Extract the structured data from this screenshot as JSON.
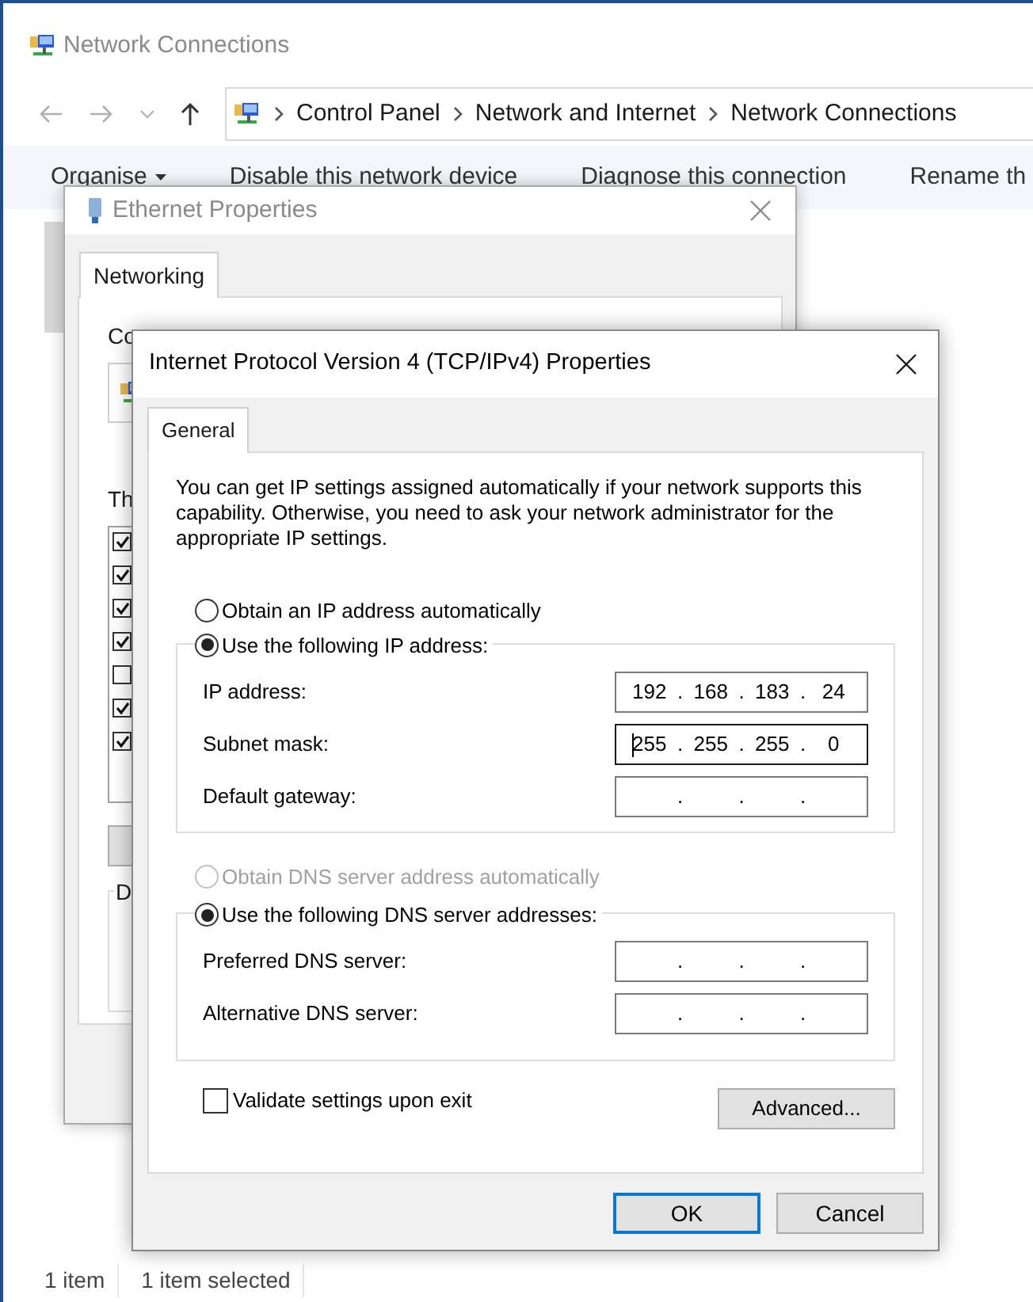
{
  "explorer": {
    "title": "Network Connections",
    "breadcrumb": [
      "Control Panel",
      "Network and Internet",
      "Network Connections"
    ],
    "toolbar": [
      {
        "label": "Organise",
        "dropdown": true
      },
      {
        "label": "Disable this network device",
        "dropdown": false
      },
      {
        "label": "Diagnose this connection",
        "dropdown": false
      },
      {
        "label": "Rename th",
        "dropdown": false
      }
    ],
    "status_bar": [
      "1 item",
      "1 item selected"
    ]
  },
  "ethernet_dialog": {
    "title": "Ethernet Properties",
    "tabs": [
      {
        "label": "Networking",
        "selected": true
      }
    ],
    "connect_label": "Co",
    "components_label": "Th",
    "components": [
      {
        "checked": true
      },
      {
        "checked": true
      },
      {
        "checked": true
      },
      {
        "checked": true
      },
      {
        "checked": false
      },
      {
        "checked": true
      },
      {
        "checked": true
      }
    ],
    "group_label": "D"
  },
  "ipv4_dialog": {
    "title": "Internet Protocol Version 4 (TCP/IPv4) Properties",
    "tabs": [
      {
        "label": "General",
        "selected": true
      }
    ],
    "description": "You can get IP settings assigned automatically if your network supports this capability. Otherwise, you need to ask your network administrator for the appropriate IP settings.",
    "ip_auto": {
      "label": "Obtain an IP address automatically",
      "selected": false,
      "disabled": false
    },
    "ip_manual": {
      "label": "Use the following IP address:",
      "selected": true,
      "disabled": false
    },
    "ip_fields": [
      {
        "label": "IP address:",
        "focused": false,
        "parts": [
          {
            "kind": "octet",
            "text": "192"
          },
          {
            "kind": "dot",
            "text": "."
          },
          {
            "kind": "octet",
            "text": "168"
          },
          {
            "kind": "dot",
            "text": "."
          },
          {
            "kind": "octet",
            "text": "183"
          },
          {
            "kind": "dot",
            "text": "."
          },
          {
            "kind": "octet",
            "text": "24"
          }
        ]
      },
      {
        "label": "Subnet mask:",
        "focused": true,
        "parts": [
          {
            "kind": "octet",
            "text": "255"
          },
          {
            "kind": "dot",
            "text": "."
          },
          {
            "kind": "octet",
            "text": "255"
          },
          {
            "kind": "dot",
            "text": "."
          },
          {
            "kind": "octet",
            "text": "255"
          },
          {
            "kind": "dot",
            "text": "."
          },
          {
            "kind": "octet",
            "text": "0"
          }
        ]
      },
      {
        "label": "Default gateway:",
        "focused": false,
        "parts": [
          {
            "kind": "octet"
          },
          {
            "kind": "dot",
            "text": "."
          },
          {
            "kind": "octet"
          },
          {
            "kind": "dot",
            "text": "."
          },
          {
            "kind": "octet"
          },
          {
            "kind": "dot",
            "text": "."
          },
          {
            "kind": "octet"
          }
        ]
      }
    ],
    "dns_auto": {
      "label": "Obtain DNS server address automatically",
      "selected": false,
      "disabled": true
    },
    "dns_manual": {
      "label": "Use the following DNS server addresses:",
      "selected": true,
      "disabled": false
    },
    "dns_fields": [
      {
        "label": "Preferred DNS server:",
        "focused": false,
        "parts": [
          {
            "kind": "octet"
          },
          {
            "kind": "dot",
            "text": "."
          },
          {
            "kind": "octet"
          },
          {
            "kind": "dot",
            "text": "."
          },
          {
            "kind": "octet"
          },
          {
            "kind": "dot",
            "text": "."
          },
          {
            "kind": "octet"
          }
        ]
      },
      {
        "label": "Alternative DNS server:",
        "focused": false,
        "parts": [
          {
            "kind": "octet"
          },
          {
            "kind": "dot",
            "text": "."
          },
          {
            "kind": "octet"
          },
          {
            "kind": "dot",
            "text": "."
          },
          {
            "kind": "octet"
          },
          {
            "kind": "dot",
            "text": "."
          },
          {
            "kind": "octet"
          }
        ]
      }
    ],
    "validate": {
      "label": "Validate settings upon exit",
      "checked": false
    },
    "advanced_button": "Advanced...",
    "ok_button": {
      "label": "OK",
      "default": true
    },
    "cancel_button": {
      "label": "Cancel",
      "default": false
    }
  }
}
